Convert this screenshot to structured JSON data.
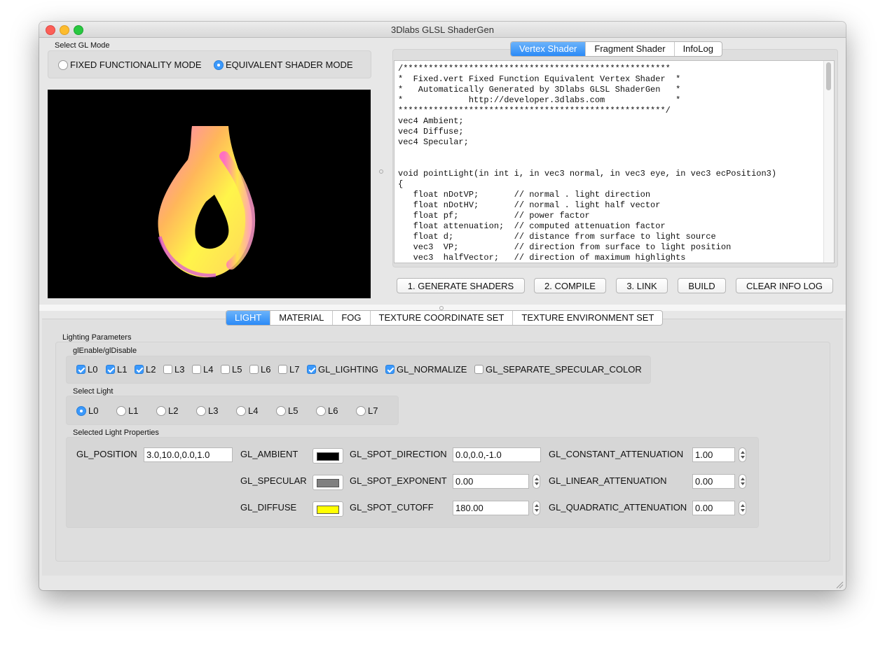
{
  "window": {
    "title": "3Dlabs GLSL ShaderGen"
  },
  "gl_mode": {
    "group_label": "Select GL Mode",
    "options": [
      "FIXED FUNCTIONALITY MODE",
      "EQUIVALENT SHADER MODE"
    ],
    "selected": "EQUIVALENT SHADER MODE"
  },
  "shader_tabs": {
    "tabs": [
      "Vertex Shader",
      "Fragment Shader",
      "InfoLog"
    ],
    "active": "Vertex Shader"
  },
  "code": "/*****************************************************\n*  Fixed.vert Fixed Function Equivalent Vertex Shader  *\n*   Automatically Generated by 3Dlabs GLSL ShaderGen   *\n*             http://developer.3dlabs.com              *\n*****************************************************/\nvec4 Ambient;\nvec4 Diffuse;\nvec4 Specular;\n\n\nvoid pointLight(in int i, in vec3 normal, in vec3 eye, in vec3 ecPosition3)\n{\n   float nDotVP;       // normal . light direction\n   float nDotHV;       // normal . light half vector\n   float pf;           // power factor\n   float attenuation;  // computed attenuation factor\n   float d;            // distance from surface to light source\n   vec3  VP;           // direction from surface to light position\n   vec3  halfVector;   // direction of maximum highlights",
  "actions": [
    "1. GENERATE SHADERS",
    "2. COMPILE",
    "3. LINK",
    "BUILD",
    "CLEAR INFO LOG"
  ],
  "bottom_tabs": {
    "tabs": [
      "LIGHT",
      "MATERIAL",
      "FOG",
      "TEXTURE COORDINATE SET",
      "TEXTURE ENVIRONMENT SET"
    ],
    "active": "LIGHT"
  },
  "lighting": {
    "group_label": "Lighting Parameters",
    "enable_label": "glEnable/glDisable",
    "enables": [
      {
        "label": "L0",
        "checked": true
      },
      {
        "label": "L1",
        "checked": true
      },
      {
        "label": "L2",
        "checked": true
      },
      {
        "label": "L3",
        "checked": false
      },
      {
        "label": "L4",
        "checked": false
      },
      {
        "label": "L5",
        "checked": false
      },
      {
        "label": "L6",
        "checked": false
      },
      {
        "label": "L7",
        "checked": false
      },
      {
        "label": "GL_LIGHTING",
        "checked": true
      },
      {
        "label": "GL_NORMALIZE",
        "checked": true
      },
      {
        "label": "GL_SEPARATE_SPECULAR_COLOR",
        "checked": false
      }
    ],
    "select_label": "Select Light",
    "lights": [
      "L0",
      "L1",
      "L2",
      "L3",
      "L4",
      "L5",
      "L6",
      "L7"
    ],
    "selected_light": "L0",
    "props_label": "Selected Light Properties",
    "position": {
      "label": "GL_POSITION",
      "value": "3.0,10.0,0.0,1.0"
    },
    "ambient": {
      "label": "GL_AMBIENT",
      "color": "#000000"
    },
    "specular": {
      "label": "GL_SPECULAR",
      "color": "#808080"
    },
    "diffuse": {
      "label": "GL_DIFFUSE",
      "color": "#ffff00"
    },
    "spot_direction": {
      "label": "GL_SPOT_DIRECTION",
      "value": "0.0,0.0,-1.0"
    },
    "spot_exponent": {
      "label": "GL_SPOT_EXPONENT",
      "value": "0.00"
    },
    "spot_cutoff": {
      "label": "GL_SPOT_CUTOFF",
      "value": "180.00"
    },
    "constant_att": {
      "label": "GL_CONSTANT_ATTENUATION",
      "value": "1.00"
    },
    "linear_att": {
      "label": "GL_LINEAR_ATTENUATION",
      "value": "0.00"
    },
    "quadratic_att": {
      "label": "GL_QUADRATIC_ATTENUATION",
      "value": "0.00"
    }
  },
  "colors": {
    "accent": "#3b99fc",
    "viewport_bg": "#000000"
  }
}
